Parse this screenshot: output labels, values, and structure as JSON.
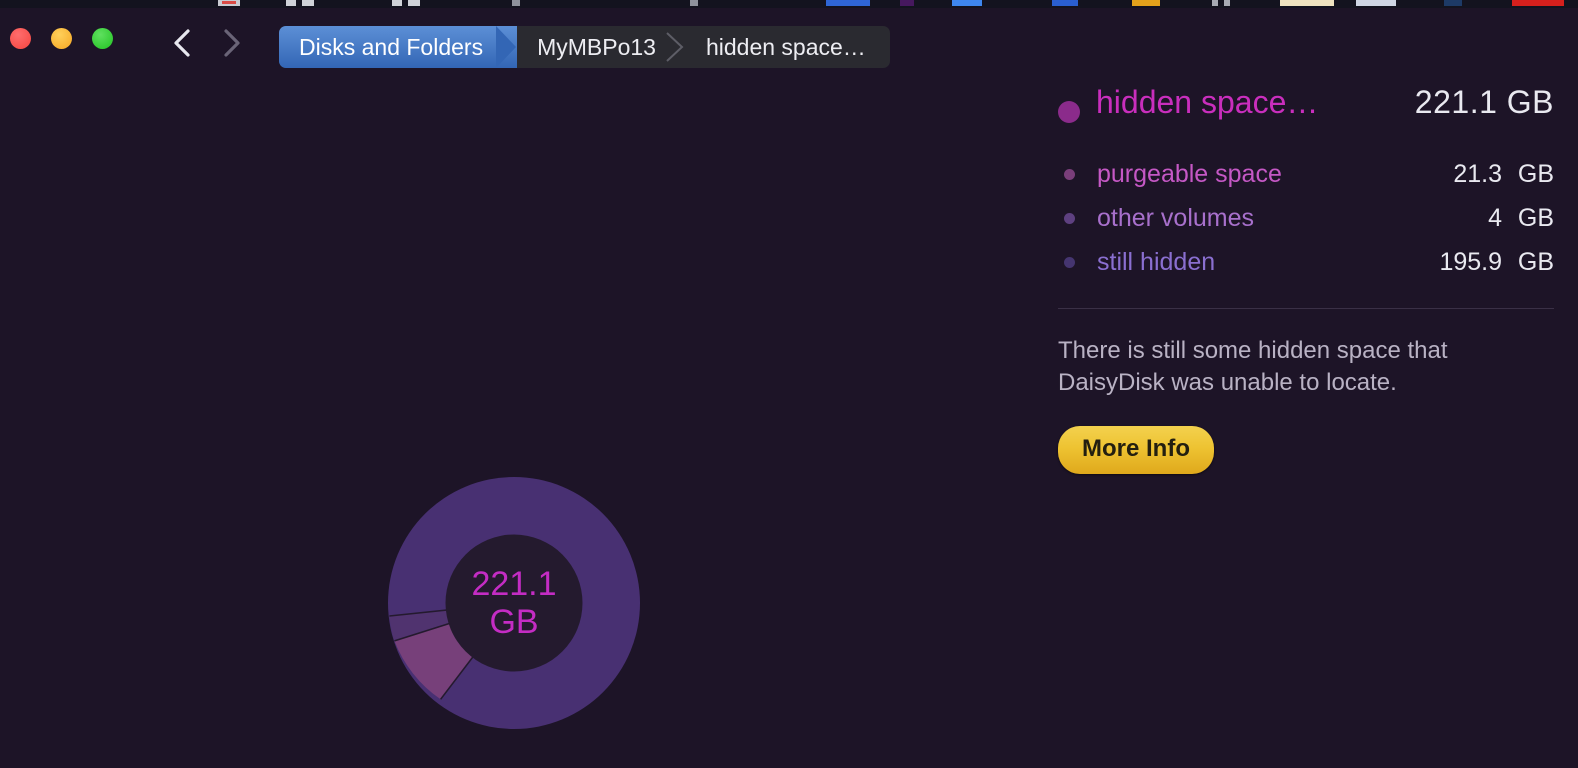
{
  "window": {
    "traffic_lights": [
      {
        "name": "close",
        "color": "#f4453f"
      },
      {
        "name": "minimize",
        "color": "#f5a623"
      },
      {
        "name": "zoom",
        "color": "#22c322"
      }
    ],
    "back_label": "‹",
    "forward_label": "›"
  },
  "breadcrumbs": [
    {
      "label": "Disks and Folders",
      "active": true
    },
    {
      "label": "MyMBPo13",
      "active": false
    },
    {
      "label": "hidden space…",
      "active": false
    }
  ],
  "panel": {
    "main": {
      "label": "hidden space…",
      "value": "221.1 GB",
      "dot_color": "#8b2b8b",
      "label_color": "#c92ebd"
    },
    "items": [
      {
        "label": "purgeable space",
        "number": "21.3",
        "unit": "GB",
        "dot_color": "#7a3e7a",
        "label_color": "#c558c5"
      },
      {
        "label": "other volumes",
        "number": "4",
        "unit": "GB",
        "dot_color": "#5e4080",
        "label_color": "#a870cc"
      },
      {
        "label": "still hidden",
        "number": "195.9",
        "unit": "GB",
        "dot_color": "#453570",
        "label_color": "#8a6fd0"
      }
    ],
    "note": "There is still some hidden space that DaisyDisk was unable to locate.",
    "more_info_label": "More Info"
  },
  "donut": {
    "center_value": "221.1",
    "center_unit": "GB",
    "ring_color_outer": "#483072",
    "hole_color": "#241a2e"
  },
  "chart_data": {
    "type": "pie",
    "title": "hidden space…",
    "total": 221.1,
    "unit": "GB",
    "categories": [
      "purgeable space",
      "other volumes",
      "still hidden"
    ],
    "values": [
      21.3,
      4,
      195.9
    ],
    "colors": [
      "#77407a",
      "#50336f",
      "#483072"
    ],
    "legend_position": "right",
    "center_label": "221.1 GB",
    "donut": true,
    "inner_radius_ratio": 0.545
  }
}
